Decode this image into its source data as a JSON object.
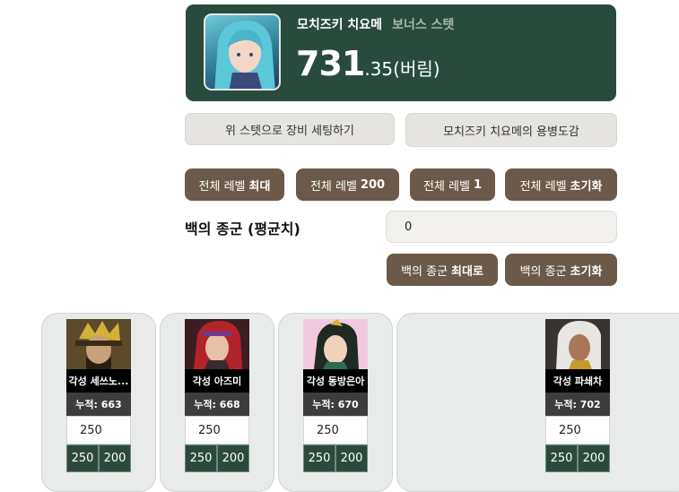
{
  "banner": {
    "hero_name": "모치즈키 치요메",
    "bonus_label": "보너스 스텟",
    "value_big": "731",
    "value_small": ".35(버림)"
  },
  "actions": {
    "equip_setting": "위 스텟으로 장비 세팅하기",
    "mercenary_book": "모치즈키 치요메의 용병도감"
  },
  "level_buttons": [
    {
      "prefix": "전체 레벨",
      "bold": "최대"
    },
    {
      "prefix": "전체 레벨",
      "bold": "200"
    },
    {
      "prefix": "전체 레벨",
      "bold": "1"
    },
    {
      "prefix": "전체 레벨",
      "bold": "초기화"
    }
  ],
  "average": {
    "label": "백의 종군 (평균치)",
    "value": "0"
  },
  "average_buttons": [
    {
      "prefix": "백의 종군",
      "bold": "최대로"
    },
    {
      "prefix": "백의 종군",
      "bold": "초기화"
    }
  ],
  "characters": [
    {
      "name": "각성 세쓰노...",
      "accum": "누적: 663",
      "level": "250",
      "btn1": "250",
      "btn2": "200"
    },
    {
      "name": "각성 아즈미",
      "accum": "누적: 668",
      "level": "250",
      "btn1": "250",
      "btn2": "200"
    },
    {
      "name": "각성 동방은아",
      "accum": "누적: 670",
      "level": "250",
      "btn1": "250",
      "btn2": "200"
    },
    {
      "name": "각성 파쇄차",
      "accum": "누적: 702",
      "level": "250",
      "btn1": "250",
      "btn2": "200"
    }
  ],
  "colors": {
    "banner_bg": "#284b3d",
    "brown_button": "#6b5a49",
    "card_bg": "#e8ebe9",
    "dark_green_button": "#2c4a3c"
  }
}
